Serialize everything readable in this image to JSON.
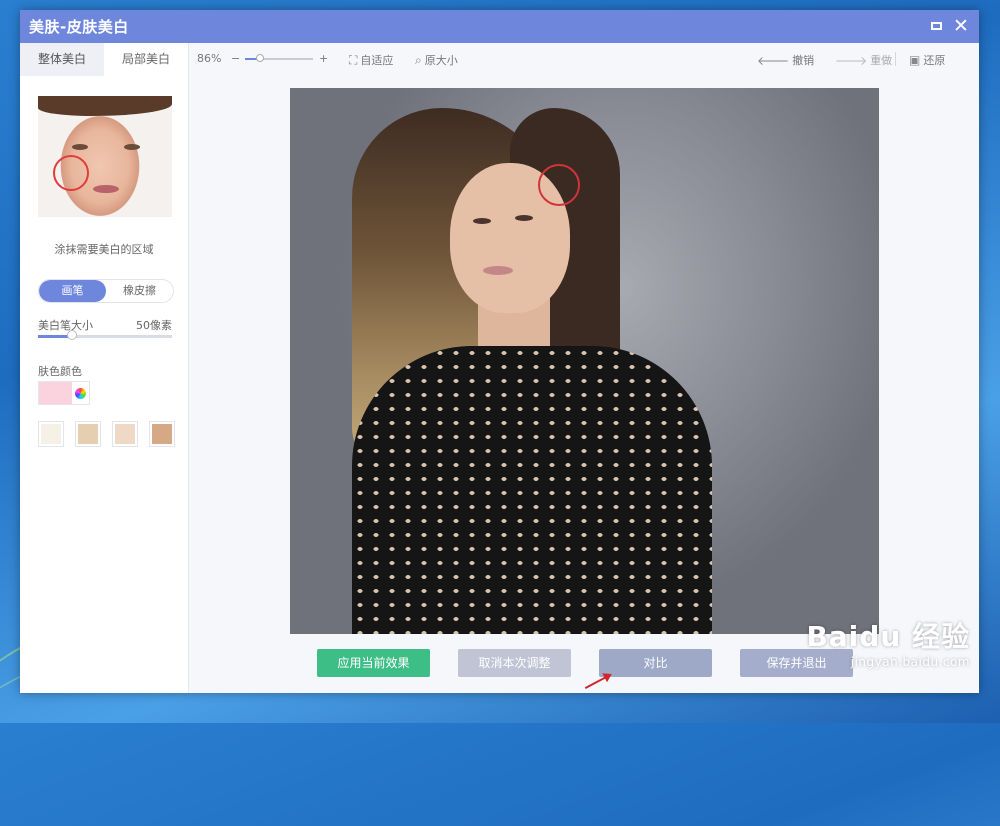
{
  "window": {
    "title": "美肤-皮肤美白"
  },
  "left": {
    "tabs": [
      {
        "label": "整体美白"
      },
      {
        "label": "局部美白"
      }
    ],
    "hint": "涂抹需要美白的区域",
    "brush_modes": [
      {
        "label": "画笔"
      },
      {
        "label": "橡皮擦"
      }
    ],
    "brush_size_label": "美白笔大小",
    "brush_size_value": "50像素",
    "brush_size_level": 0.25,
    "skin_color_label": "肤色颜色",
    "current_color": "#fbd3de",
    "swatches": [
      "#f6f1e6",
      "#e5cfb0",
      "#efd9c6",
      "#d5a886"
    ]
  },
  "toolbar": {
    "zoom_percent": "86%",
    "zoom_minus": "−",
    "zoom_plus": "+",
    "zoom_level": 0.22,
    "fit_label": "自适应",
    "original_size_label": "原大小",
    "undo_label": "撤销",
    "redo_label": "重做",
    "restore_label": "还原"
  },
  "buttons": {
    "apply": "应用当前效果",
    "cancel": "取消本次调整",
    "compare": "对比",
    "save": "保存并退出"
  },
  "watermark": {
    "logo": "Baidu 经验",
    "url": "jingyan.baidu.com"
  }
}
